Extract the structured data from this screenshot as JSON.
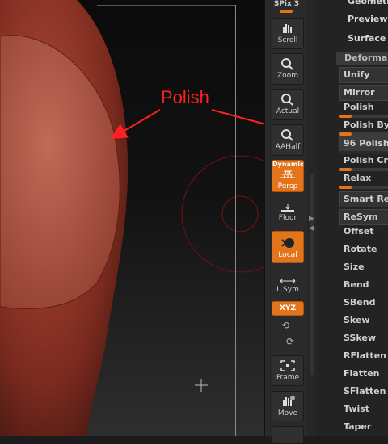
{
  "toolbar": {
    "spix": "SPix 3",
    "scroll": "Scroll",
    "zoom": "Zoom",
    "actual": "Actual",
    "aahalf": "AAHalf",
    "dynamic": "Dynamic",
    "persp": "Persp",
    "floor": "Floor",
    "local": "Local",
    "lsym": "L.Sym",
    "xyz": "XYZ",
    "frame": "Frame",
    "move": "Move"
  },
  "top_menu": [
    "Geometr",
    "Preview",
    "Surface"
  ],
  "deformation": {
    "header": "Deforma",
    "unify": "Unify",
    "mirror": "Mirror",
    "polish": "Polish",
    "polish_by": "Polish By",
    "polish_value": "96 Polish",
    "polish_crisp": "Polish Cri",
    "relax": "Relax",
    "smart_resym": "Smart Re",
    "resym": "ReSym",
    "items": [
      "Offset",
      "Rotate",
      "Size",
      "Bend",
      "SBend",
      "Skew",
      "SSkew",
      "RFlatten",
      "Flatten",
      "SFlatten",
      "Twist",
      "Taper"
    ]
  },
  "annotation": {
    "text": "Polish",
    "color": "#ff2020"
  },
  "colors": {
    "accent": "#e2741c",
    "model": "#9a3a2a"
  }
}
